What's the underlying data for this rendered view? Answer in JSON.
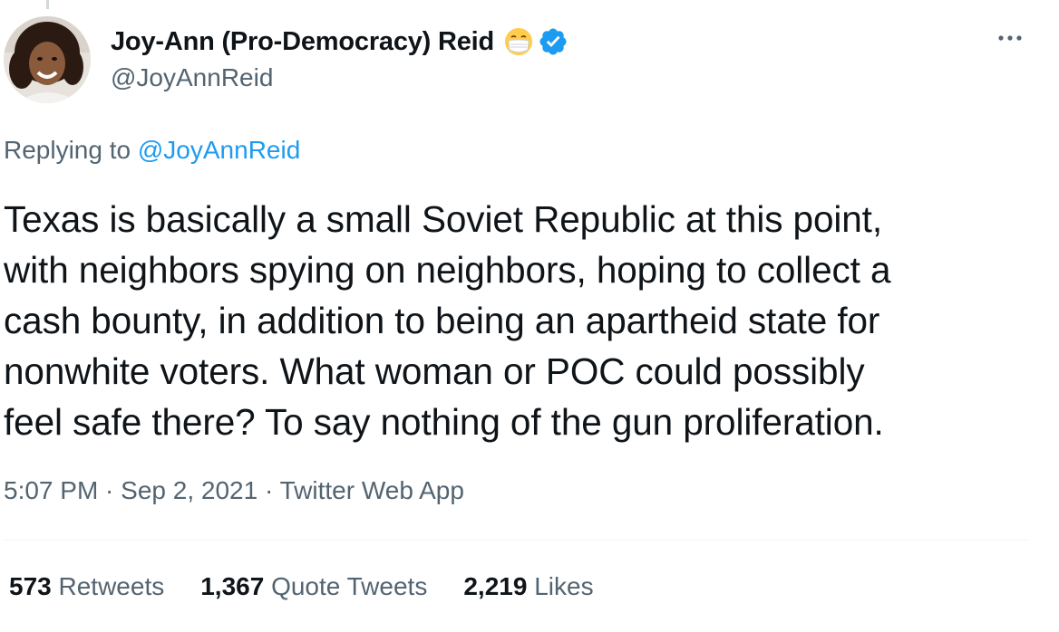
{
  "author": {
    "display_name": "Joy-Ann (Pro-Democracy) Reid",
    "handle": "@JoyAnnReid",
    "emoji_icon": "face-with-medical-mask",
    "verified_icon": "verified-badge"
  },
  "reply": {
    "prefix": "Replying to",
    "to_handle": "@JoyAnnReid"
  },
  "tweet": {
    "text": "Texas is basically a small Soviet Republic at this point,\nwith neighbors spying on neighbors, hoping to collect a\ncash bounty, in addition to being an apartheid state for\nnonwhite voters. What woman or POC could possibly\nfeel safe there? To say nothing of the gun proliferation."
  },
  "meta": {
    "time": "5:07 PM",
    "sep1": " · ",
    "date": "Sep 2, 2021",
    "sep2": " · ",
    "source": "Twitter Web App"
  },
  "stats": {
    "retweets_count": "573",
    "retweets_label": "Retweets",
    "quotes_count": "1,367",
    "quotes_label": "Quote Tweets",
    "likes_count": "2,219",
    "likes_label": "Likes"
  },
  "colors": {
    "text": "#0f1419",
    "secondary": "#536471",
    "link": "#1d9bf0",
    "verified": "#1d9bf0"
  }
}
